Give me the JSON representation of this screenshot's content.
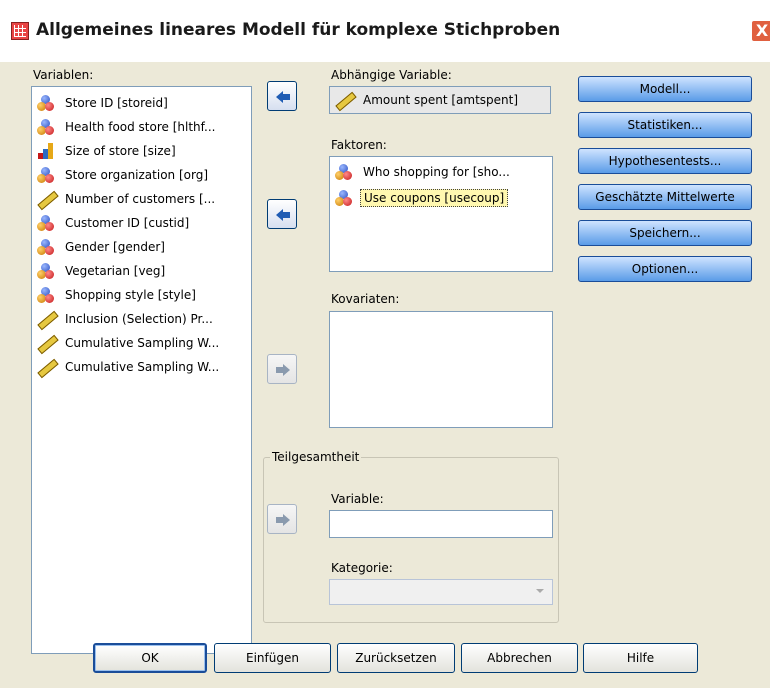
{
  "window": {
    "title": "Allgemeines lineares Modell für komplexe Stichproben",
    "close_glyph": "X"
  },
  "variables": {
    "label": "Variablen:",
    "items": [
      {
        "label": "Store ID [storeid]",
        "icon": "nominal-icon"
      },
      {
        "label": "Health food store [hlthf...",
        "icon": "nominal-icon"
      },
      {
        "label": "Size of store [size]",
        "icon": "ordinal-icon"
      },
      {
        "label": "Store organization [org]",
        "icon": "nominal-icon"
      },
      {
        "label": "Number of customers [...",
        "icon": "scale-icon"
      },
      {
        "label": "Customer ID [custid]",
        "icon": "nominal-icon"
      },
      {
        "label": "Gender [gender]",
        "icon": "nominal-icon"
      },
      {
        "label": "Vegetarian [veg]",
        "icon": "nominal-icon"
      },
      {
        "label": "Shopping style [style]",
        "icon": "nominal-icon"
      },
      {
        "label": "Inclusion (Selection) Pr...",
        "icon": "scale-icon"
      },
      {
        "label": "Cumulative Sampling W...",
        "icon": "scale-icon"
      },
      {
        "label": "Cumulative Sampling W...",
        "icon": "scale-icon"
      }
    ]
  },
  "dependent": {
    "label": "Abhängige Variable:",
    "value": "Amount spent [amtspent]",
    "icon": "scale-icon"
  },
  "factors": {
    "label": "Faktoren:",
    "items": [
      {
        "label": "Who shopping for [sho...",
        "icon": "nominal-icon",
        "selected": false
      },
      {
        "label": "Use coupons [usecoup]",
        "icon": "nominal-icon",
        "selected": true
      }
    ]
  },
  "covariates": {
    "label": "Kovariaten:"
  },
  "subpopulation": {
    "title": "Teilgesamtheit",
    "variable_label": "Variable:",
    "variable_value": "",
    "category_label": "Kategorie:",
    "category_value": ""
  },
  "side_buttons": [
    "Modell...",
    "Statistiken...",
    "Hypothesentests...",
    "Geschätzte Mittelwerte",
    "Speichern...",
    "Optionen..."
  ],
  "bottom_buttons": [
    "OK",
    "Einfügen",
    "Zurücksetzen",
    "Abbrechen",
    "Hilfe"
  ],
  "colors": {
    "side_button": "#5a9be8",
    "selection": "#fff8b0",
    "dialog_bg": "#ece9d8"
  }
}
